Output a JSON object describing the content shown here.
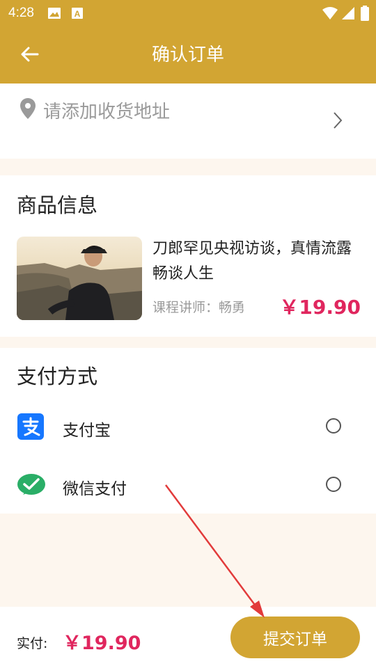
{
  "status_bar": {
    "time": "4:28",
    "icons": [
      "image-icon",
      "a-box-icon",
      "wifi-icon",
      "signal-icon",
      "battery-icon"
    ]
  },
  "header": {
    "title": "确认订单",
    "back_icon": "arrow-left-icon"
  },
  "address": {
    "placeholder": "请添加收货地址",
    "icon": "location-pin-icon"
  },
  "goods": {
    "section_title": "商品信息",
    "product": {
      "title": "刀郎罕见央视访谈，真情流露畅谈人生",
      "teacher": "课程讲师：畅勇",
      "price": "￥19.90"
    }
  },
  "payment": {
    "section_title": "支付方式",
    "options": [
      {
        "label": "支付宝",
        "icon": "alipay-icon",
        "color": "#1677ff",
        "selected": false
      },
      {
        "label": "微信支付",
        "icon": "wechat-pay-icon",
        "color": "#2aae67",
        "selected": false
      }
    ]
  },
  "footer": {
    "total_label": "实付:",
    "total_value": "￥19.90",
    "submit_label": "提交订单"
  },
  "colors": {
    "brand": "#d2a533",
    "price": "#e0265e",
    "annotation_arrow": "#e23b3b"
  }
}
